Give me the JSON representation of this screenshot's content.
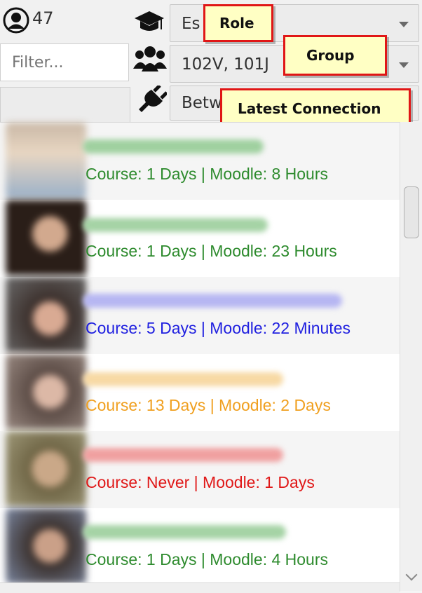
{
  "header": {
    "user_count": "47",
    "filter_placeholder": "Filter...",
    "role_value": "Es",
    "group_value": "102V, 101J",
    "connection_value": "Betw"
  },
  "tooltips": {
    "role": "Role",
    "group": "Group",
    "latest_connection": "Latest Connection"
  },
  "colors": {
    "green": "#2e8b2e",
    "blue": "#2020e0",
    "orange": "#f0a020",
    "red": "#e01818"
  },
  "students": [
    {
      "stats": "Course: 1 Days | Moodle: 8 Hours",
      "color": "#2e8b2e"
    },
    {
      "stats": "Course: 1 Days | Moodle: 23 Hours",
      "color": "#2e8b2e"
    },
    {
      "stats": "Course: 5 Days | Moodle: 22 Minutes",
      "color": "#2020e0"
    },
    {
      "stats": "Course: 13 Days | Moodle: 2 Days",
      "color": "#f0a020"
    },
    {
      "stats": "Course:  Never | Moodle: 1 Days",
      "color": "#e01818"
    },
    {
      "stats": "Course: 1 Days | Moodle: 4 Hours",
      "color": "#2e8b2e"
    }
  ]
}
